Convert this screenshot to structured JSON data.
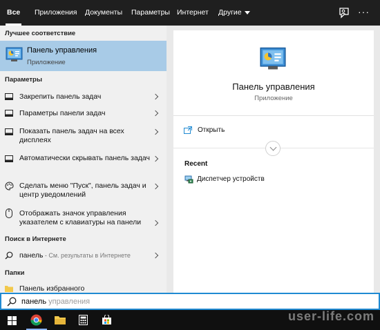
{
  "tabs": [
    {
      "label": "Все",
      "active": true
    },
    {
      "label": "Приложения"
    },
    {
      "label": "Документы"
    },
    {
      "label": "Параметры"
    },
    {
      "label": "Интернет"
    },
    {
      "label": "Другие"
    }
  ],
  "left": {
    "best_match_header": "Лучшее соответствие",
    "best_match": {
      "title": "Панель управления",
      "subtitle": "Приложение"
    },
    "settings_header": "Параметры",
    "settings_items": [
      {
        "text": "Закрепить панель задач",
        "icon": "taskbar-icon"
      },
      {
        "text": "Параметры панели задач",
        "icon": "taskbar-icon"
      },
      {
        "text": "Показать панель задач на всех дисплеях",
        "icon": "taskbar-icon"
      },
      {
        "text": "Автоматически скрывать панель задач",
        "icon": "taskbar-icon"
      },
      {
        "text": "Сделать меню \"Пуск\", панель задач и центр уведомлений",
        "icon": "palette-icon"
      },
      {
        "text": "Отображать значок управления указателем с клавиатуры на панели",
        "icon": "mouse-icon"
      }
    ],
    "web_header": "Поиск в Интернете",
    "web_item": {
      "query": "панель",
      "hint": " - См. результаты в Интернете"
    },
    "folders_header": "Папки",
    "folder_item": "Панель избранного"
  },
  "right": {
    "title": "Панель управления",
    "subtitle": "Приложение",
    "open_label": "Открыть",
    "recent_header": "Recent",
    "recent_items": [
      "Диспетчер устройств"
    ]
  },
  "search": {
    "typed": "панель",
    "completion": " управления"
  },
  "watermark": "user-life.com",
  "colors": {
    "accent": "#1f8ad2",
    "best_match_bg": "#a8cbe7",
    "topbar": "#1f1f1f",
    "taskbar": "#101010"
  }
}
